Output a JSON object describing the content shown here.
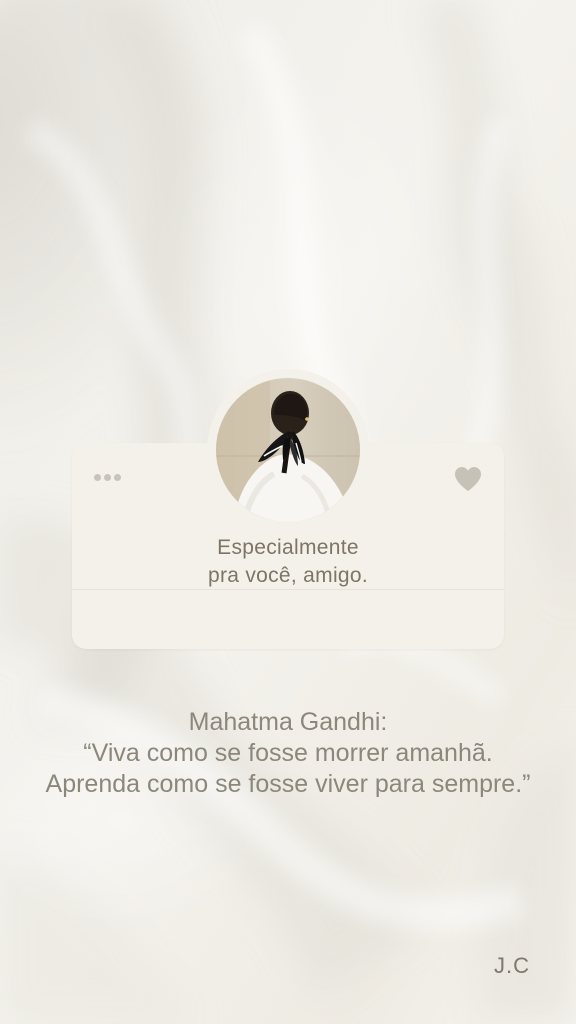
{
  "card": {
    "caption_line1": "Especialmente",
    "caption_line2": "pra você, amigo.",
    "menu_icon": "more-dots-icon",
    "favorite_icon": "heart-icon"
  },
  "avatar": {
    "description": "avatar"
  },
  "quote": {
    "line1": "Mahatma Gandhi:",
    "line2": "“Viva como se fosse morrer amanhã.",
    "line3": "Aprenda como se fosse viver para sempre.”"
  },
  "signature": "J.C",
  "colors": {
    "card": "#f3f1ea",
    "caption": "#7e7564",
    "quote": "#8d877b",
    "heart": "#c7c2b7",
    "dots": "#c8c4bb"
  }
}
